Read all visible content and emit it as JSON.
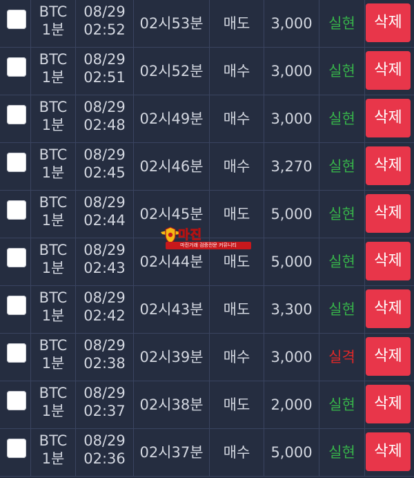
{
  "rows": [
    {
      "symbol": "BTC",
      "interval": "1분",
      "date": "08/29",
      "time": "02:52",
      "round": "02시53분",
      "side": "매도",
      "amount": "3,000",
      "result": "실현",
      "result_type": "ok",
      "delete_label": "삭제"
    },
    {
      "symbol": "BTC",
      "interval": "1분",
      "date": "08/29",
      "time": "02:51",
      "round": "02시52분",
      "side": "매수",
      "amount": "3,000",
      "result": "실현",
      "result_type": "ok",
      "delete_label": "삭제"
    },
    {
      "symbol": "BTC",
      "interval": "1분",
      "date": "08/29",
      "time": "02:48",
      "round": "02시49분",
      "side": "매수",
      "amount": "3,000",
      "result": "실현",
      "result_type": "ok",
      "delete_label": "삭제"
    },
    {
      "symbol": "BTC",
      "interval": "1분",
      "date": "08/29",
      "time": "02:45",
      "round": "02시46분",
      "side": "매수",
      "amount": "3,270",
      "result": "실현",
      "result_type": "ok",
      "delete_label": "삭제"
    },
    {
      "symbol": "BTC",
      "interval": "1분",
      "date": "08/29",
      "time": "02:44",
      "round": "02시45분",
      "side": "매도",
      "amount": "5,000",
      "result": "실현",
      "result_type": "ok",
      "delete_label": "삭제"
    },
    {
      "symbol": "BTC",
      "interval": "1분",
      "date": "08/29",
      "time": "02:43",
      "round": "02시44분",
      "side": "매도",
      "amount": "5,000",
      "result": "실현",
      "result_type": "ok",
      "delete_label": "삭제"
    },
    {
      "symbol": "BTC",
      "interval": "1분",
      "date": "08/29",
      "time": "02:42",
      "round": "02시43분",
      "side": "매도",
      "amount": "3,300",
      "result": "실현",
      "result_type": "ok",
      "delete_label": "삭제"
    },
    {
      "symbol": "BTC",
      "interval": "1분",
      "date": "08/29",
      "time": "02:38",
      "round": "02시39분",
      "side": "매수",
      "amount": "3,000",
      "result": "실격",
      "result_type": "fail",
      "delete_label": "삭제"
    },
    {
      "symbol": "BTC",
      "interval": "1분",
      "date": "08/29",
      "time": "02:37",
      "round": "02시38분",
      "side": "매도",
      "amount": "2,000",
      "result": "실현",
      "result_type": "ok",
      "delete_label": "삭제"
    },
    {
      "symbol": "BTC",
      "interval": "1분",
      "date": "08/29",
      "time": "02:36",
      "round": "02시37분",
      "side": "매수",
      "amount": "5,000",
      "result": "실현",
      "result_type": "ok",
      "delete_label": "삭제"
    }
  ],
  "watermark": {
    "brand": "마진",
    "tagline": "마진거래 검증전문 커뮤니티"
  },
  "colors": {
    "background": "#252d40",
    "success": "#37b34a",
    "fail": "#e02828",
    "delete_button": "#e8364a"
  },
  "icons": {
    "checkbox": "checkbox-icon",
    "watermark_emblem": "shield-wings-icon"
  }
}
